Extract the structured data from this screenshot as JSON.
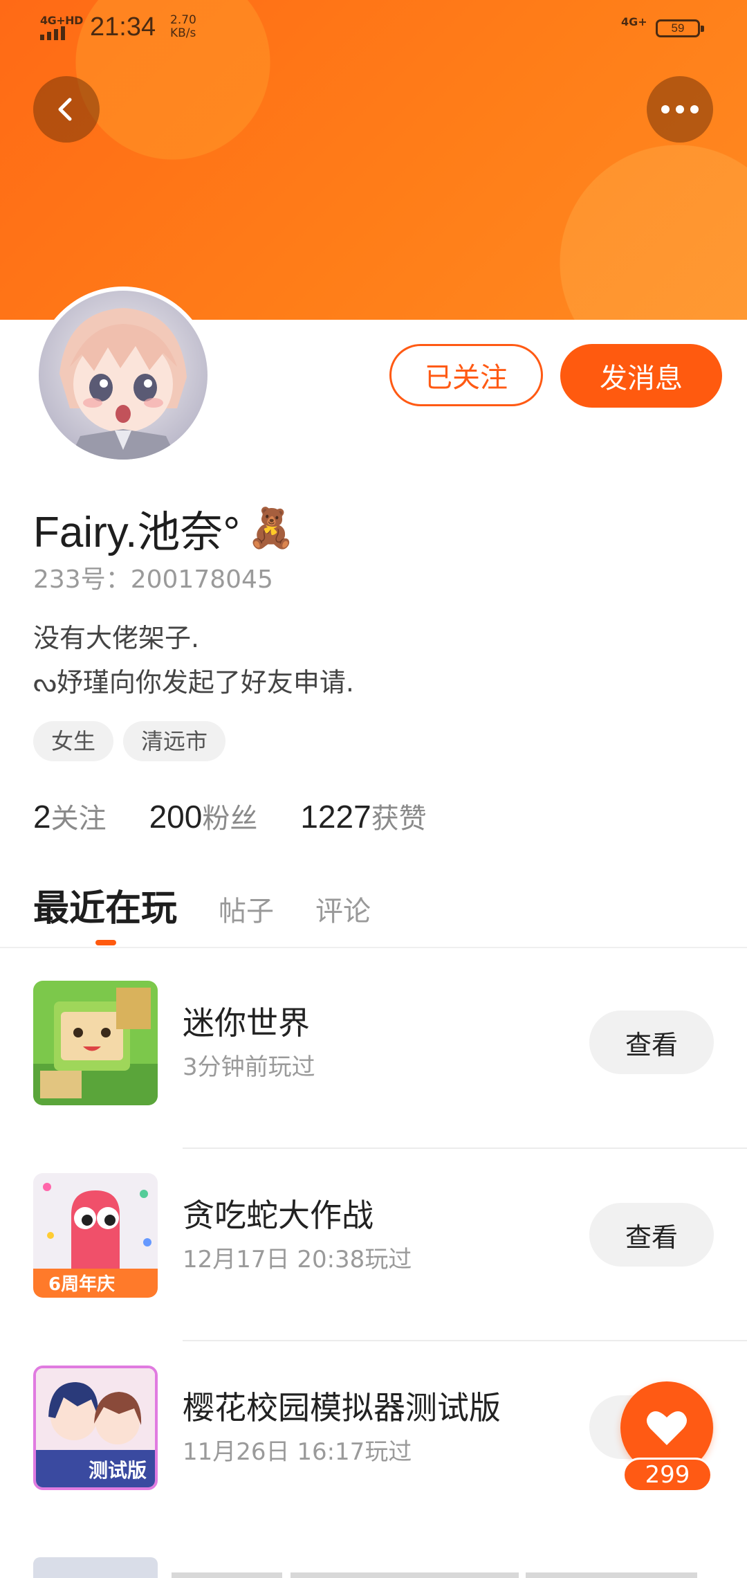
{
  "status_bar": {
    "network_left": "4G+HD",
    "time": "21:34",
    "speed_value": "2.70",
    "speed_unit": "KB/s",
    "network_right": "4G+",
    "battery": "59"
  },
  "header": {
    "back_icon": "back-arrow-icon",
    "more_icon": "more-dots-icon",
    "banner_color": "#ff7a1a"
  },
  "profile": {
    "name": "Fairy.池奈°",
    "name_emoji": "🧸",
    "id_text": "233号：200178045",
    "bio_line1": "没有大佬架子.",
    "bio_line2": "ᔓ妤瑾向你发起了好友申请.",
    "tags": [
      "女生",
      "清远市"
    ],
    "follow_button": "已关注",
    "message_button": "发消息"
  },
  "stats": {
    "following_num": "2",
    "following_label": "关注",
    "fans_num": "200",
    "fans_label": "粉丝",
    "likes_num": "1227",
    "likes_label": "获赞"
  },
  "tabs": [
    "最近在玩",
    "帖子",
    "评论"
  ],
  "games": [
    {
      "name": "迷你世界",
      "time": "3分钟前玩过",
      "button": "查看"
    },
    {
      "name": "贪吃蛇大作战",
      "time": "12月17日 20:38玩过",
      "button": "查看"
    },
    {
      "name": "樱花校园模拟器测试版",
      "time": "11月26日 16:17玩过",
      "button": "查看"
    }
  ],
  "game_icon_badges": {
    "snake": "6周年庆",
    "sakura": "测试版"
  },
  "like_fab": {
    "count": "299",
    "icon": "heart-icon"
  },
  "accent_color": "#ff5a0f"
}
